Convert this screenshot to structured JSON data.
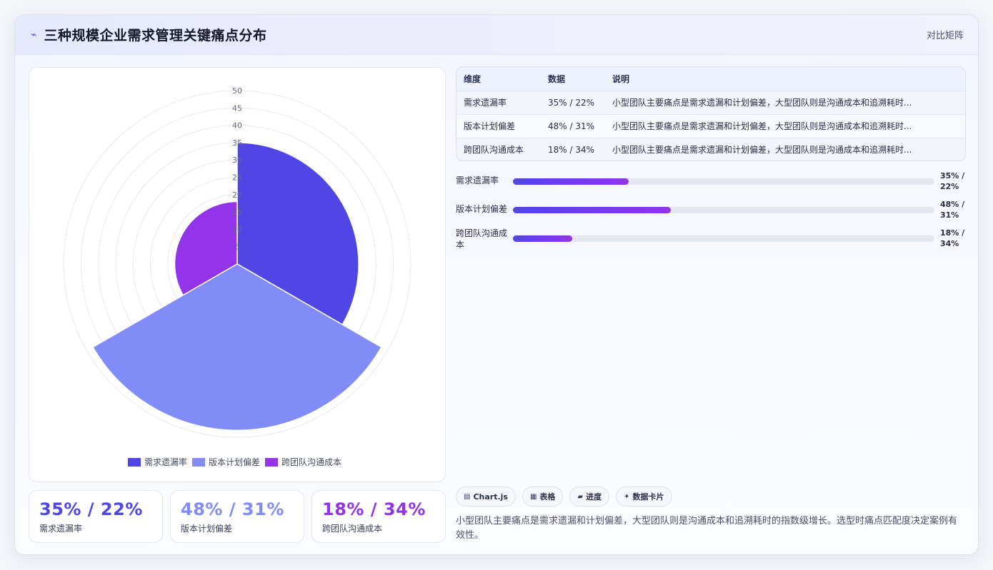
{
  "header": {
    "icon": "pulse-icon",
    "title": "三种规模企业需求管理关键痛点分布",
    "link_label": "对比矩阵"
  },
  "chart_data": {
    "type": "polarArea",
    "categories": [
      "需求遗漏率",
      "版本计划偏差",
      "跨团队沟通成本"
    ],
    "values": [
      35,
      48,
      18
    ],
    "colors": [
      "#4f46e5",
      "#818cf8",
      "#9333ea"
    ],
    "r_axis": {
      "min": 0,
      "max": 50,
      "step": 5,
      "ticks": [
        "50",
        "45",
        "40",
        "35",
        "30",
        "25",
        "20",
        "15",
        "10",
        "5"
      ]
    },
    "legend": {
      "position": "bottom",
      "labels": [
        "需求遗漏率",
        "版本计划偏差",
        "跨团队沟通成本"
      ]
    },
    "grid": true
  },
  "stats": [
    {
      "value": "35% / 22%",
      "label": "需求遗漏率",
      "color": "#4f46e5"
    },
    {
      "value": "48% / 31%",
      "label": "版本计划偏差",
      "color": "#818cf8"
    },
    {
      "value": "18% / 34%",
      "label": "跨团队沟通成本",
      "color": "#9333ea"
    }
  ],
  "table": {
    "headers": [
      "维度",
      "数据",
      "说明"
    ],
    "rows": [
      [
        "需求遗漏率",
        "35% / 22%",
        "小型团队主要痛点是需求遗漏和计划偏差，大型团队则是沟通成本和追溯耗时..."
      ],
      [
        "版本计划偏差",
        "48% / 31%",
        "小型团队主要痛点是需求遗漏和计划偏差，大型团队则是沟通成本和追溯耗时..."
      ],
      [
        "跨团队沟通成本",
        "18% / 34%",
        "小型团队主要痛点是需求遗漏和计划偏差，大型团队则是沟通成本和追溯耗时..."
      ]
    ]
  },
  "progress": [
    {
      "label": "需求遗漏率",
      "value_line1": "35% /",
      "value_line2": "22%",
      "fraction": 0.275
    },
    {
      "label": "版本计划偏差",
      "value_line1": "48% /",
      "value_line2": "31%",
      "fraction": 0.375
    },
    {
      "label": "跨团队沟通成本",
      "value_line1": "18% /",
      "value_line2": "34%",
      "fraction": 0.14
    }
  ],
  "chips": [
    {
      "icon": "chart-icon",
      "glyph": "▤",
      "label": "Chart.js"
    },
    {
      "icon": "table-icon",
      "glyph": "▦",
      "label": "表格"
    },
    {
      "icon": "progress-icon",
      "glyph": "▰",
      "label": "进度"
    },
    {
      "icon": "sparkle-icon",
      "glyph": "✦",
      "label": "数据卡片"
    }
  ],
  "summary": "小型团队主要痛点是需求遗漏和计划偏差，大型团队则是沟通成本和追溯耗时的指数级增长。选型时痛点匹配度决定案例有效性。"
}
